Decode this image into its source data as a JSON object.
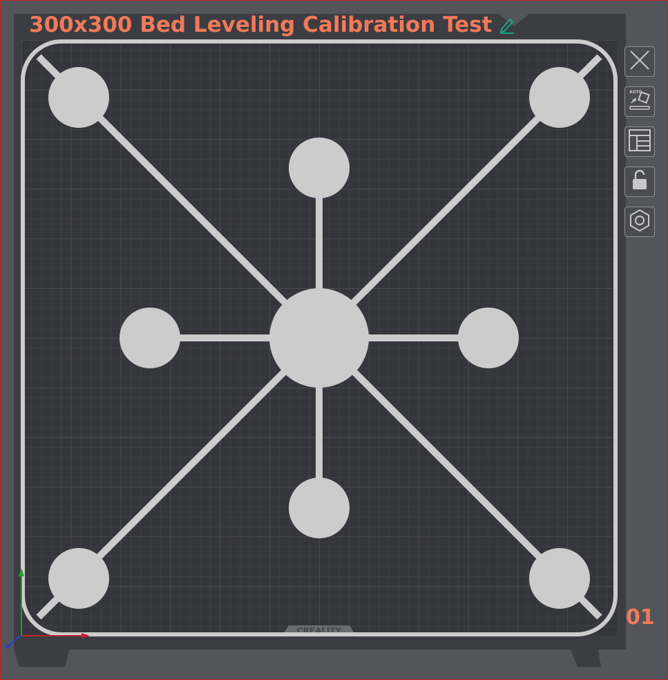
{
  "plate": {
    "title": "300x300 Bed Leveling Calibration Test",
    "number": "01",
    "brand_logo_text": "CREALITY"
  },
  "toolbar": {
    "buttons": [
      {
        "name": "close",
        "icon": "close-icon"
      },
      {
        "name": "auto-arrange",
        "icon": "auto-arrange-icon"
      },
      {
        "name": "layout",
        "icon": "layout-icon"
      },
      {
        "name": "lock",
        "icon": "unlock-icon"
      },
      {
        "name": "settings",
        "icon": "hexagon-settings-icon"
      }
    ]
  },
  "colors": {
    "accent": "#f07a58",
    "edit_icon": "#1aa68a",
    "bed": "#36363d",
    "grid_minor": "#45454d",
    "grid_major": "#55555d",
    "model": "#cccccc",
    "background": "#54545b",
    "axis_x": "#c0202a",
    "axis_y": "#22a32a",
    "axis_z": "#2a3acb"
  }
}
